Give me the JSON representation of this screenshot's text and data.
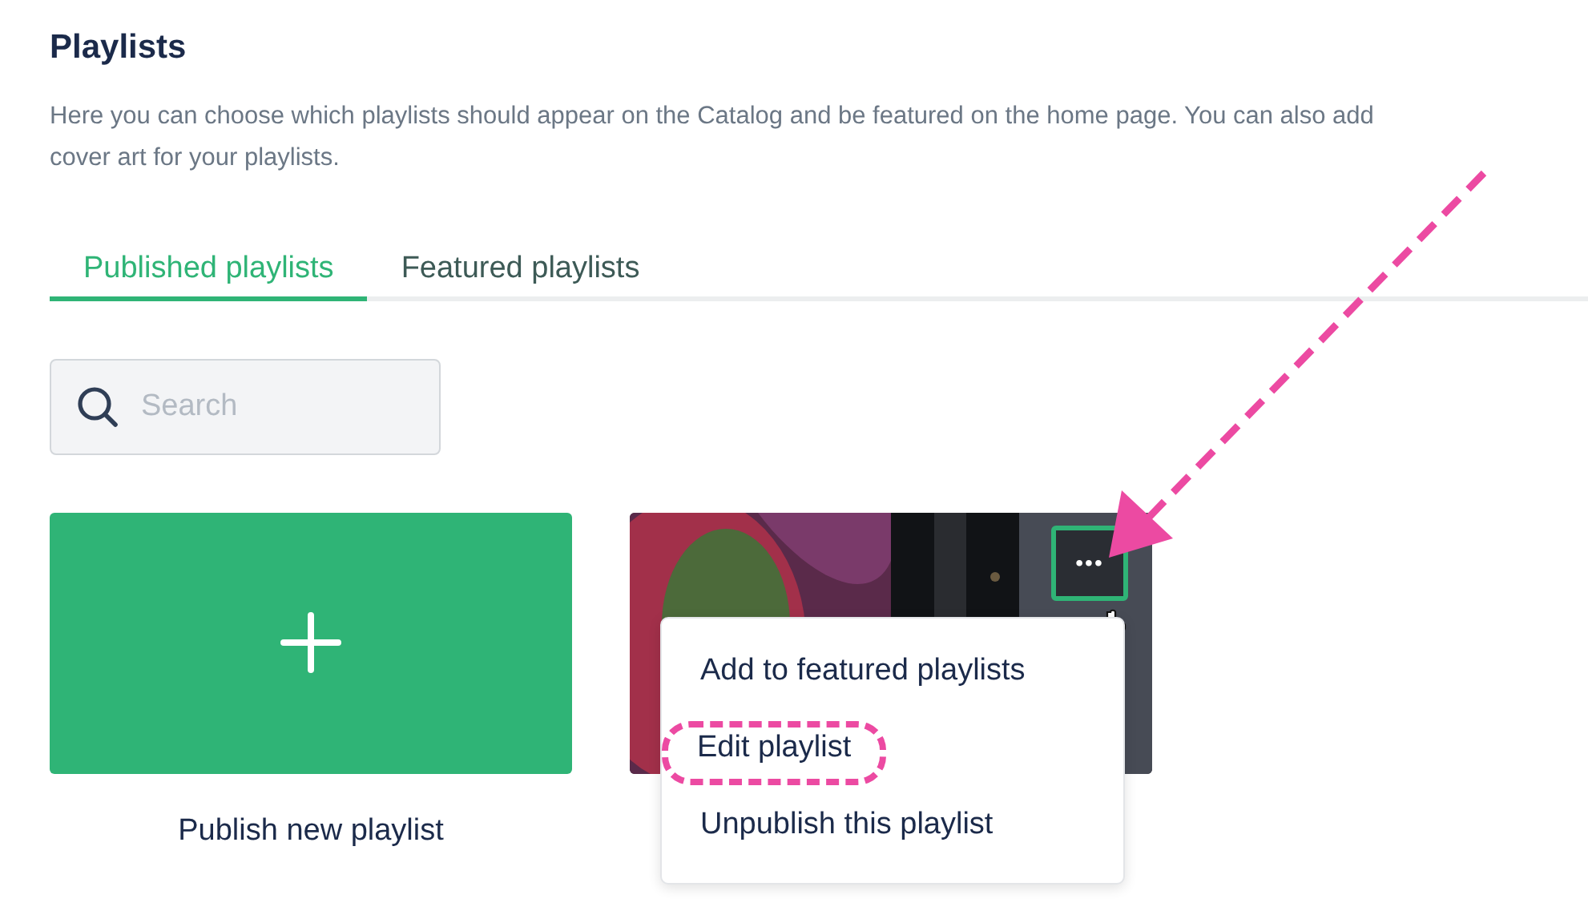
{
  "title": "Playlists",
  "description": "Here you can choose which playlists should appear on the Catalog and be featured on the home page. You can also add cover art for your playlists.",
  "tabs": [
    {
      "label": "Published playlists",
      "selected": true
    },
    {
      "label": "Featured playlists",
      "selected": false
    }
  ],
  "search": {
    "placeholder": "Search"
  },
  "new_playlist": {
    "label": "Publish new playlist"
  },
  "playlist_card": {
    "more_button": "•••"
  },
  "menu": {
    "items": [
      {
        "label": "Add to featured playlists",
        "highlighted": false
      },
      {
        "label": "Edit playlist",
        "highlighted": true
      },
      {
        "label": "Unpublish this playlist",
        "highlighted": false
      }
    ]
  }
}
